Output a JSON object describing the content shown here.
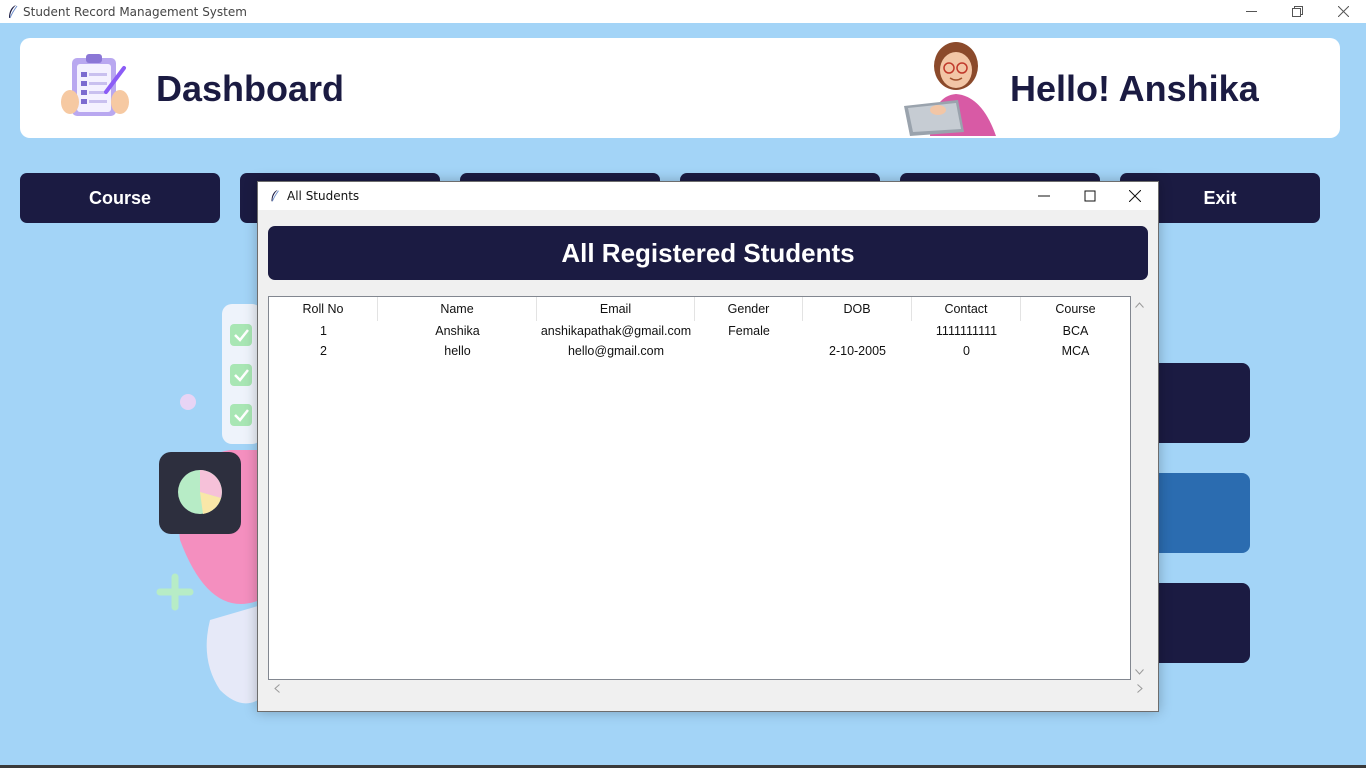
{
  "window": {
    "title": "Student Record Management System",
    "icon": "feather-icon"
  },
  "header": {
    "title": "Dashboard",
    "greeting": "Hello! Anshika"
  },
  "nav": {
    "buttons": [
      {
        "label": "Course"
      },
      {
        "label": ""
      },
      {
        "label": ""
      },
      {
        "label": ""
      },
      {
        "label": ""
      },
      {
        "label": "Exit"
      }
    ]
  },
  "dialog": {
    "title": "All Students",
    "banner": "All Registered Students",
    "table": {
      "columns": [
        "Roll No",
        "Name",
        "Email",
        "Gender",
        "DOB",
        "Contact",
        "Course"
      ],
      "rows": [
        {
          "roll": "1",
          "name": "Anshika",
          "email": "anshikapathak@gmail.com",
          "gender": "Female",
          "dob": "",
          "contact": "1111111111",
          "course": "BCA"
        },
        {
          "roll": "2",
          "name": "hello",
          "email": "hello@gmail.com",
          "gender": "",
          "dob": "2-10-2005",
          "contact": "0",
          "course": "MCA"
        }
      ]
    }
  },
  "colors": {
    "background": "#a3d4f7",
    "navy": "#1b1b42",
    "accent_blue": "#2b6cb0",
    "white": "#ffffff"
  }
}
